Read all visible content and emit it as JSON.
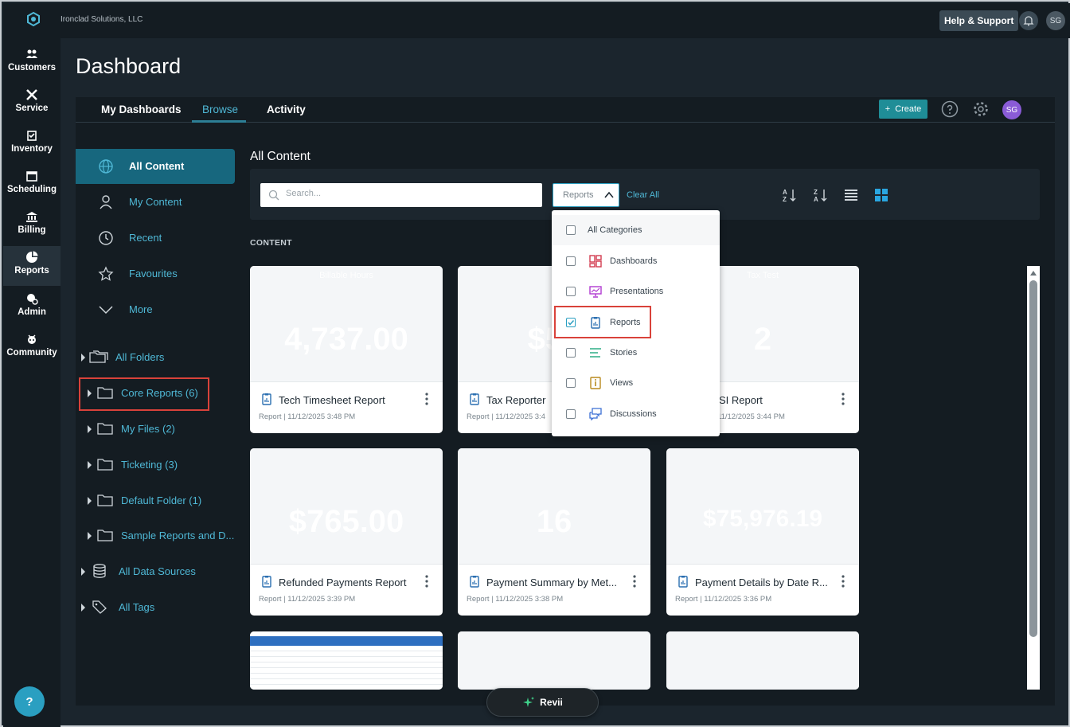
{
  "app": {
    "org_name": "Ironclad Solutions, LLC"
  },
  "topbar": {
    "help_support": "Help & Support",
    "avatar_initials": "SG"
  },
  "left_nav": {
    "items": [
      {
        "label": "Customers",
        "icon": "customers-icon"
      },
      {
        "label": "Service",
        "icon": "service-icon"
      },
      {
        "label": "Inventory",
        "icon": "inventory-icon"
      },
      {
        "label": "Scheduling",
        "icon": "calendar-icon"
      },
      {
        "label": "Billing",
        "icon": "bank-icon"
      },
      {
        "label": "Reports",
        "icon": "pie-chart-icon",
        "active": true
      },
      {
        "label": "Admin",
        "icon": "admin-icon"
      },
      {
        "label": "Community",
        "icon": "community-icon"
      }
    ],
    "help_label": "?"
  },
  "page": {
    "title": "Dashboard"
  },
  "tabs": [
    {
      "label": "My Dashboards"
    },
    {
      "label": "Browse",
      "active": true
    },
    {
      "label": "Activity"
    }
  ],
  "toolbar": {
    "create_label": "Create",
    "create_plus": "+",
    "avatar_initials": "SG"
  },
  "sidebar": {
    "items": [
      {
        "label": "All Content",
        "active": true
      },
      {
        "label": "My Content"
      },
      {
        "label": "Recent"
      },
      {
        "label": "Favourites"
      },
      {
        "label": "More"
      }
    ],
    "tree": [
      {
        "label": "All Folders"
      },
      {
        "label": "Core Reports (6)"
      },
      {
        "label": "My Files (2)"
      },
      {
        "label": "Ticketing (3)"
      },
      {
        "label": "Default Folder (1)"
      },
      {
        "label": "Sample Reports and D..."
      },
      {
        "label": "All Data Sources"
      },
      {
        "label": "All Tags"
      }
    ]
  },
  "content": {
    "title": "All Content",
    "search_placeholder": "Search...",
    "category_value": "Reports",
    "clear_all": "Clear All",
    "section_label": "CONTENT"
  },
  "category_dropdown": {
    "options": [
      {
        "label": "All Categories",
        "checked": false
      },
      {
        "label": "Dashboards",
        "checked": false
      },
      {
        "label": "Presentations",
        "checked": false
      },
      {
        "label": "Reports",
        "checked": true
      },
      {
        "label": "Stories",
        "checked": false
      },
      {
        "label": "Views",
        "checked": false
      },
      {
        "label": "Discussions",
        "checked": false
      }
    ]
  },
  "cards": [
    {
      "title": "Tech Timesheet Report",
      "meta": "Report  |  11/12/2025 3:48 PM",
      "preview": "4,737.00",
      "caption": "Billable Hours"
    },
    {
      "title": "Tax Reporter",
      "meta": "Report  |  11/12/2025 3:4",
      "preview": "$54",
      "caption": ""
    },
    {
      "title": "SI Report",
      "meta": "11/12/2025 3:44 PM",
      "preview": "2",
      "caption": "Tax Test"
    },
    {
      "title": "Refunded Payments Report",
      "meta": "Report  |  11/12/2025 3:39 PM",
      "preview": "$765.00",
      "caption": ""
    },
    {
      "title": "Payment Summary by Met...",
      "meta": "Report  |  11/12/2025 3:38 PM",
      "preview": "16",
      "caption": ""
    },
    {
      "title": "Payment Details by Date R...",
      "meta": "Report  |  11/12/2025 3:36 PM",
      "preview": "$75,976.19",
      "caption": ""
    },
    {
      "title": "",
      "meta": "",
      "preview": "",
      "caption": ""
    },
    {
      "title": "",
      "meta": "",
      "preview": "",
      "caption": ""
    },
    {
      "title": "",
      "meta": "",
      "preview": "",
      "caption": ""
    }
  ],
  "revii": {
    "label": "Revii"
  },
  "colors": {
    "accent": "#4fb8d6",
    "active_bg": "#17677e",
    "highlight": "#d9423a",
    "create": "#1f8d97"
  }
}
